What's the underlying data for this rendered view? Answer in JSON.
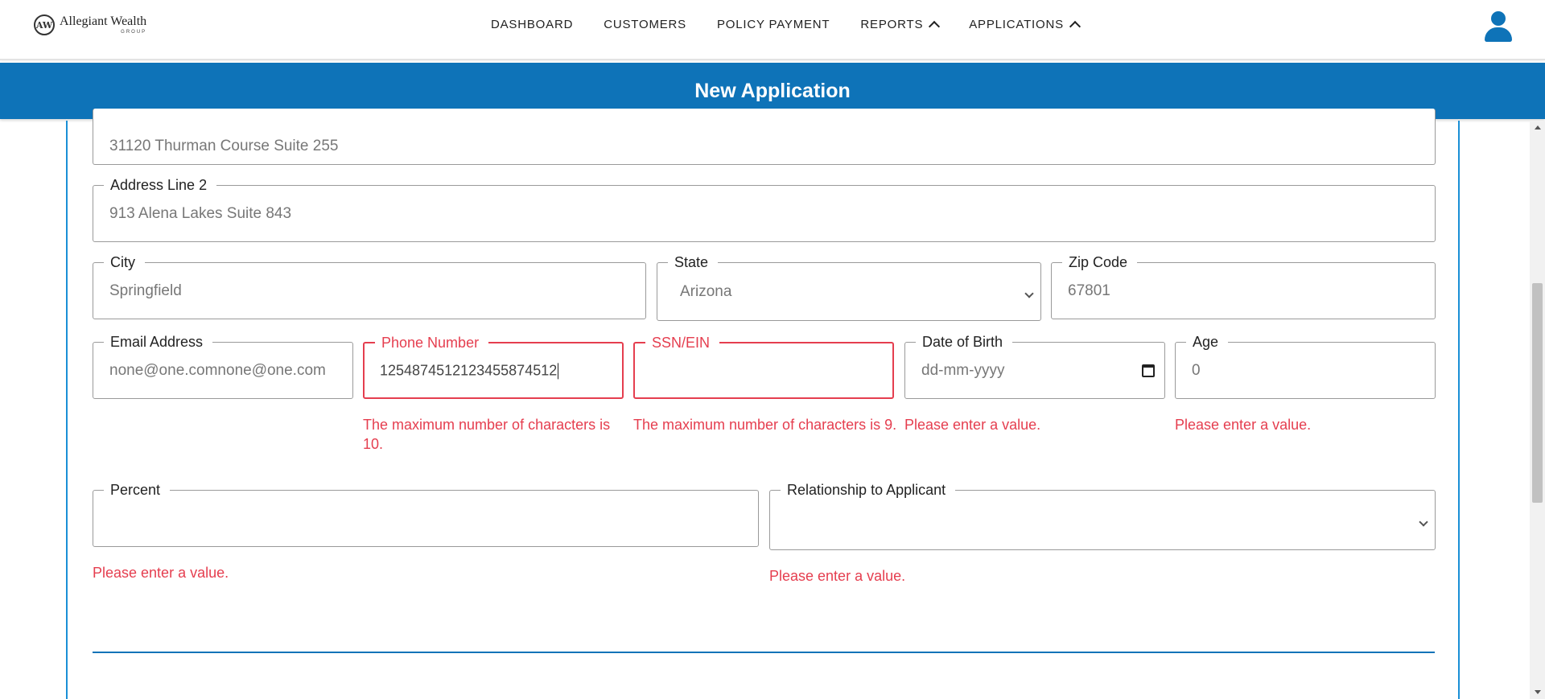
{
  "brand": {
    "name": "Allegiant Wealth",
    "sub": "GROUP",
    "mark": "AW"
  },
  "nav": [
    {
      "label": "DASHBOARD",
      "chevron": false
    },
    {
      "label": "CUSTOMERS",
      "chevron": false
    },
    {
      "label": "POLICY PAYMENT",
      "chevron": false
    },
    {
      "label": "REPORTS",
      "chevron": true
    },
    {
      "label": "APPLICATIONS",
      "chevron": true
    }
  ],
  "page": {
    "title": "New Application"
  },
  "form": {
    "address_line_1": {
      "value": "31120 Thurman Course Suite 255"
    },
    "address_line_2": {
      "label": "Address Line 2",
      "value": "913 Alena Lakes Suite 843"
    },
    "city": {
      "label": "City",
      "value": "Springfield"
    },
    "state": {
      "label": "State",
      "value": "Arizona"
    },
    "zip": {
      "label": "Zip Code",
      "value": "67801"
    },
    "email": {
      "label": "Email Address",
      "value": "none@one.comnone@one.com"
    },
    "phone": {
      "label": "Phone Number",
      "value": "1254874512123455874512",
      "error": "The maximum number of characters is 10."
    },
    "ssn": {
      "label": "SSN/EIN",
      "value": "",
      "error": "The maximum number of characters is 9."
    },
    "dob": {
      "label": "Date of Birth",
      "placeholder": "dd-mm-yyyy",
      "error": "Please enter a value."
    },
    "age": {
      "label": "Age",
      "value": "0",
      "error": "Please enter a value."
    },
    "percent": {
      "label": "Percent",
      "value": "",
      "error": "Please enter a value."
    },
    "relationship": {
      "label": "Relationship to Applicant",
      "value": "",
      "error": "Please enter a value."
    }
  },
  "colors": {
    "primary": "#0e73b8",
    "error": "#e53e4f",
    "panel_border": "#1a8fd6"
  }
}
